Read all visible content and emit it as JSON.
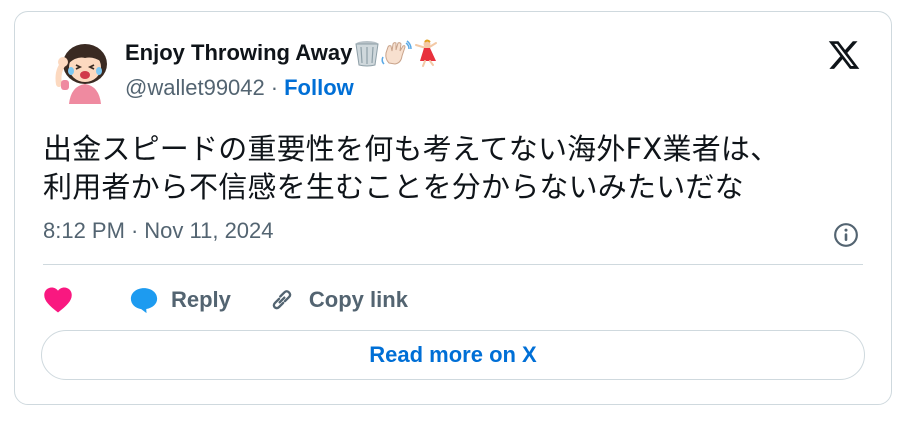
{
  "author": {
    "name": "Enjoy Throwing Away",
    "handle": "@wallet99042",
    "follow_label": "Follow",
    "emojis": [
      "wastebasket-emoji",
      "waving-hand-emoji",
      "dancer-emoji"
    ]
  },
  "separator": "·",
  "tweet": {
    "lines": [
      "出金スピードの重要性を何も考えてない海外FX業者は、",
      "利用者から不信感を生むことを分からないみたいだな"
    ]
  },
  "timestamp": {
    "time": "8:12 PM",
    "date": "Nov 11, 2024"
  },
  "actions": {
    "reply_label": "Reply",
    "copy_label": "Copy link"
  },
  "read_more_label": "Read more on X",
  "colors": {
    "link": "#006fd6",
    "secondary_text": "#536471",
    "heart": "#f91880",
    "reply_bubble": "#1d9bf0",
    "border": "#cfd9de"
  }
}
